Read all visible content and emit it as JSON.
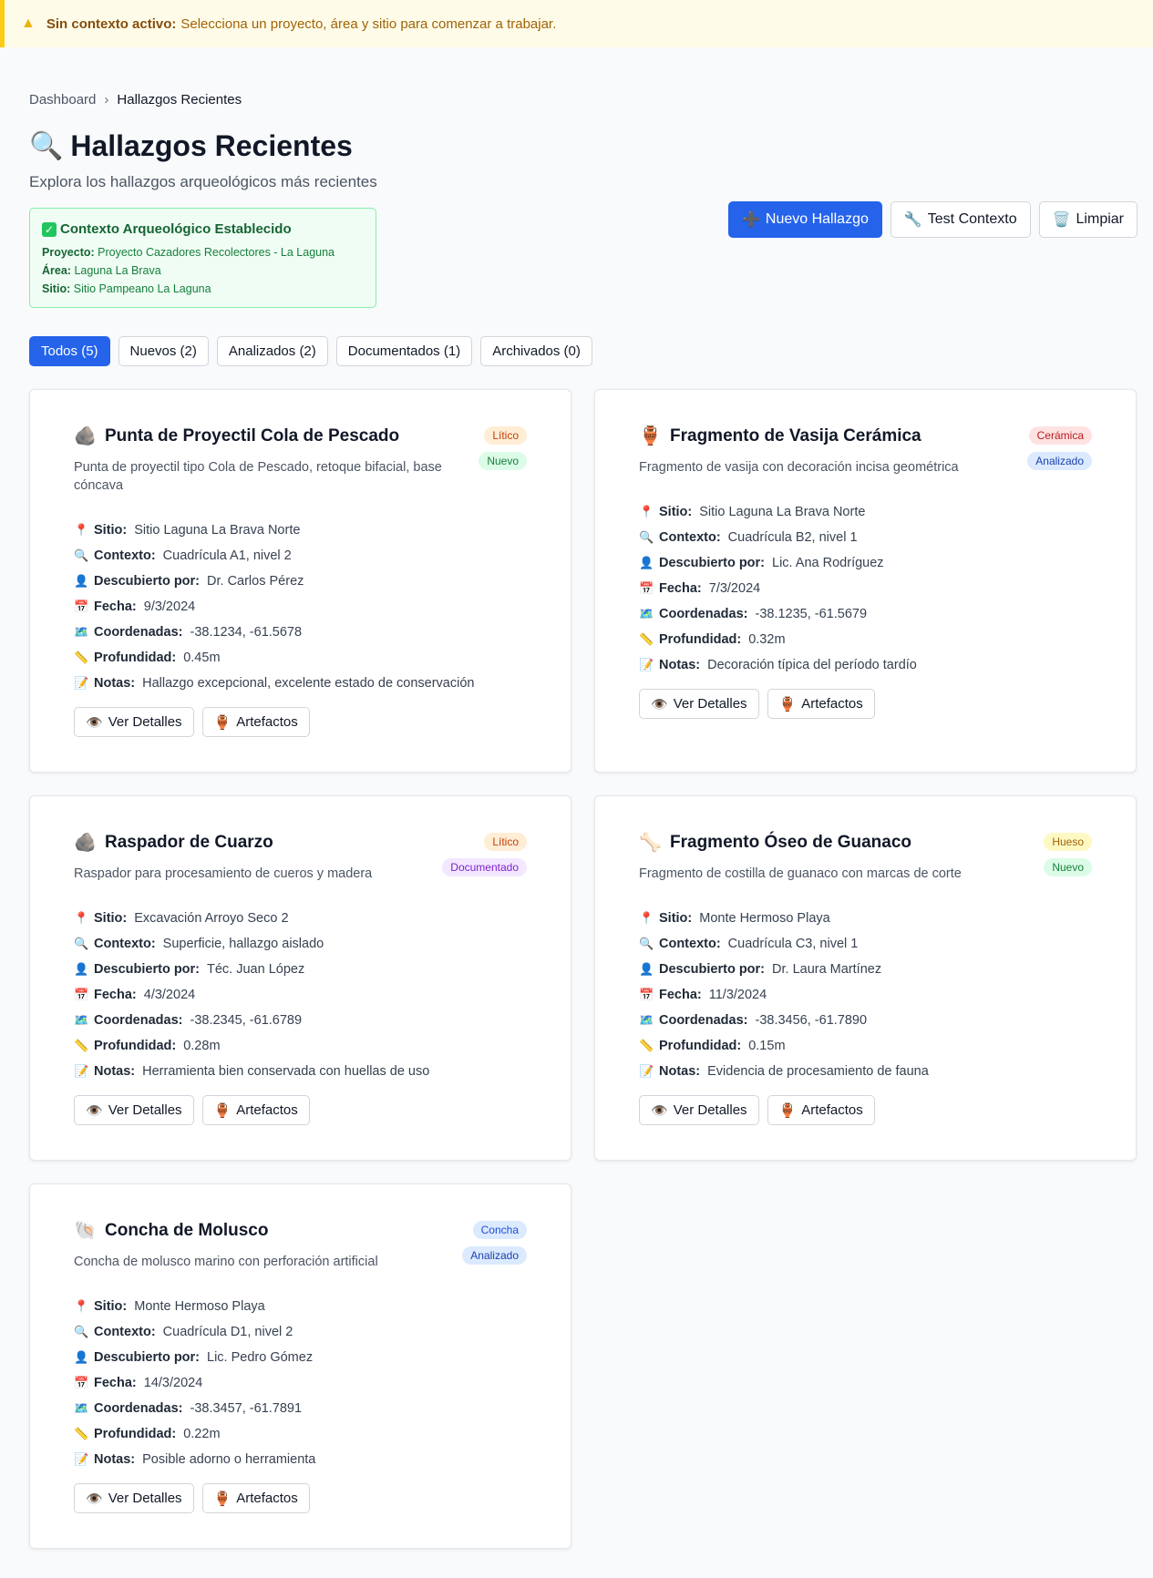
{
  "alert": {
    "icon": "warning-triangle-icon",
    "strong": "Sin contexto activo:",
    "text": "Selecciona un proyecto, área y sitio para comenzar a trabajar."
  },
  "breadcrumb": {
    "home": "Dashboard",
    "separator": "›",
    "current": "Hallazgos Recientes"
  },
  "page": {
    "title_icon": "🔍",
    "title": "Hallazgos Recientes",
    "subtitle": "Explora los hallazgos arqueológicos más recientes"
  },
  "context": {
    "heading": "Contexto Arqueológico Establecido",
    "check": "✓",
    "project_label": "Proyecto:",
    "project": "Proyecto Cazadores Recolectores - La Laguna",
    "area_label": "Área:",
    "area": "Laguna La Brava",
    "site_label": "Sitio:",
    "site": "Sitio Pampeano La Laguna"
  },
  "actions": {
    "new_icon": "➕",
    "new_label": "Nuevo Hallazgo",
    "test_icon": "🔧",
    "test_label": "Test Contexto",
    "clear_icon": "🗑️",
    "clear_label": "Limpiar"
  },
  "filters": [
    "Todos (5)",
    "Nuevos (2)",
    "Analizados (2)",
    "Documentados (1)",
    "Archivados (0)"
  ],
  "labels": {
    "site": "Sitio:",
    "context": "Contexto:",
    "discovered_by": "Descubierto por:",
    "date": "Fecha:",
    "coords": "Coordenadas:",
    "depth": "Profundidad:",
    "notes": "Notas:",
    "site_icon": "📍",
    "context_icon": "🔍",
    "discovered_icon": "👤",
    "date_icon": "📅",
    "coords_icon": "🗺️",
    "depth_icon": "📏",
    "notes_icon": "📝",
    "view_icon": "👁️",
    "view": "Ver Detalles",
    "artifacts_icon": "🏺",
    "artifacts": "Artefactos"
  },
  "findings": [
    {
      "icon": "🪨",
      "title": "Punta de Proyectil Cola de Pescado",
      "description": "Punta de proyectil tipo Cola de Pescado, retoque bifacial, base cóncava",
      "type": "Lítico",
      "status": "Nuevo",
      "site": "Sitio Laguna La Brava Norte",
      "context": "Cuadrícula A1, nivel 2",
      "discovered_by": "Dr. Carlos Pérez",
      "date": "9/3/2024",
      "coords": "-38.1234, -61.5678",
      "depth": "0.45m",
      "notes": "Hallazgo excepcional, excelente estado de conservación"
    },
    {
      "icon": "🏺",
      "title": "Fragmento de Vasija Cerámica",
      "description": "Fragmento de vasija con decoración incisa geométrica",
      "type": "Cerámica",
      "status": "Analizado",
      "site": "Sitio Laguna La Brava Norte",
      "context": "Cuadrícula B2, nivel 1",
      "discovered_by": "Lic. Ana Rodríguez",
      "date": "7/3/2024",
      "coords": "-38.1235, -61.5679",
      "depth": "0.32m",
      "notes": "Decoración típica del período tardío"
    },
    {
      "icon": "🪨",
      "title": "Raspador de Cuarzo",
      "description": "Raspador para procesamiento de cueros y madera",
      "type": "Lítico",
      "status": "Documentado",
      "site": "Excavación Arroyo Seco 2",
      "context": "Superficie, hallazgo aislado",
      "discovered_by": "Téc. Juan López",
      "date": "4/3/2024",
      "coords": "-38.2345, -61.6789",
      "depth": "0.28m",
      "notes": "Herramienta bien conservada con huellas de uso"
    },
    {
      "icon": "🦴",
      "title": "Fragmento Óseo de Guanaco",
      "description": "Fragmento de costilla de guanaco con marcas de corte",
      "type": "Hueso",
      "status": "Nuevo",
      "site": "Monte Hermoso Playa",
      "context": "Cuadrícula C3, nivel 1",
      "discovered_by": "Dr. Laura Martínez",
      "date": "11/3/2024",
      "coords": "-38.3456, -61.7890",
      "depth": "0.15m",
      "notes": "Evidencia de procesamiento de fauna"
    },
    {
      "icon": "🐚",
      "title": "Concha de Molusco",
      "description": "Concha de molusco marino con perforación artificial",
      "type": "Concha",
      "status": "Analizado",
      "site": "Monte Hermoso Playa",
      "context": "Cuadrícula D1, nivel 2",
      "discovered_by": "Lic. Pedro Gómez",
      "date": "14/3/2024",
      "coords": "-38.3457, -61.7891",
      "depth": "0.22m",
      "notes": "Posible adorno o herramienta"
    }
  ]
}
